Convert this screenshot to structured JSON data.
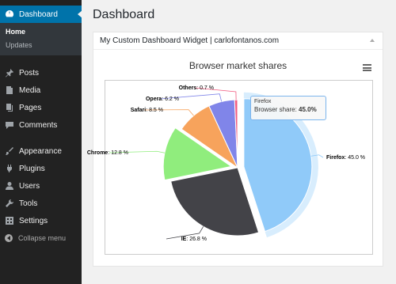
{
  "sidebar": {
    "dashboard": "Dashboard",
    "sub_home": "Home",
    "sub_updates": "Updates",
    "items": [
      {
        "label": "Posts",
        "icon": "pin-icon"
      },
      {
        "label": "Media",
        "icon": "media-icon"
      },
      {
        "label": "Pages",
        "icon": "pages-icon"
      },
      {
        "label": "Comments",
        "icon": "comment-icon"
      },
      {
        "label": "Appearance",
        "icon": "brush-icon"
      },
      {
        "label": "Plugins",
        "icon": "plug-icon"
      },
      {
        "label": "Users",
        "icon": "user-icon"
      },
      {
        "label": "Tools",
        "icon": "wrench-icon"
      },
      {
        "label": "Settings",
        "icon": "settings-icon"
      }
    ],
    "collapse": "Collapse menu"
  },
  "page_title": "Dashboard",
  "widget": {
    "title": "My Custom Dashboard Widget | carlofontanos.com"
  },
  "tooltip": {
    "name": "Firefox",
    "label": "Browser share:",
    "value": "45.0%"
  },
  "colors": {
    "accent": "#0073aa",
    "sidebar_bg": "#222222",
    "firefox": "#90caf9",
    "ie": "#434348",
    "chrome": "#90ed7d",
    "safari": "#f7a35c",
    "opera": "#8085e9",
    "others": "#f15c80"
  },
  "chart_data": {
    "type": "pie",
    "title": "Browser market shares",
    "series_name": "Browser share",
    "slices": [
      {
        "name": "Firefox",
        "value": 45.0,
        "label": "45.0 %",
        "color": "#90caf9",
        "sliced": true
      },
      {
        "name": "IE",
        "value": 26.8,
        "label": "26.8 %",
        "color": "#434348"
      },
      {
        "name": "Chrome",
        "value": 12.8,
        "label": "12.8 %",
        "color": "#90ed7d",
        "sliced": true
      },
      {
        "name": "Safari",
        "value": 8.5,
        "label": "8.5 %",
        "color": "#f7a35c"
      },
      {
        "name": "Opera",
        "value": 6.2,
        "label": "6.2 %",
        "color": "#8085e9"
      },
      {
        "name": "Others",
        "value": 0.7,
        "label": "0.7 %",
        "color": "#f15c80"
      }
    ]
  }
}
